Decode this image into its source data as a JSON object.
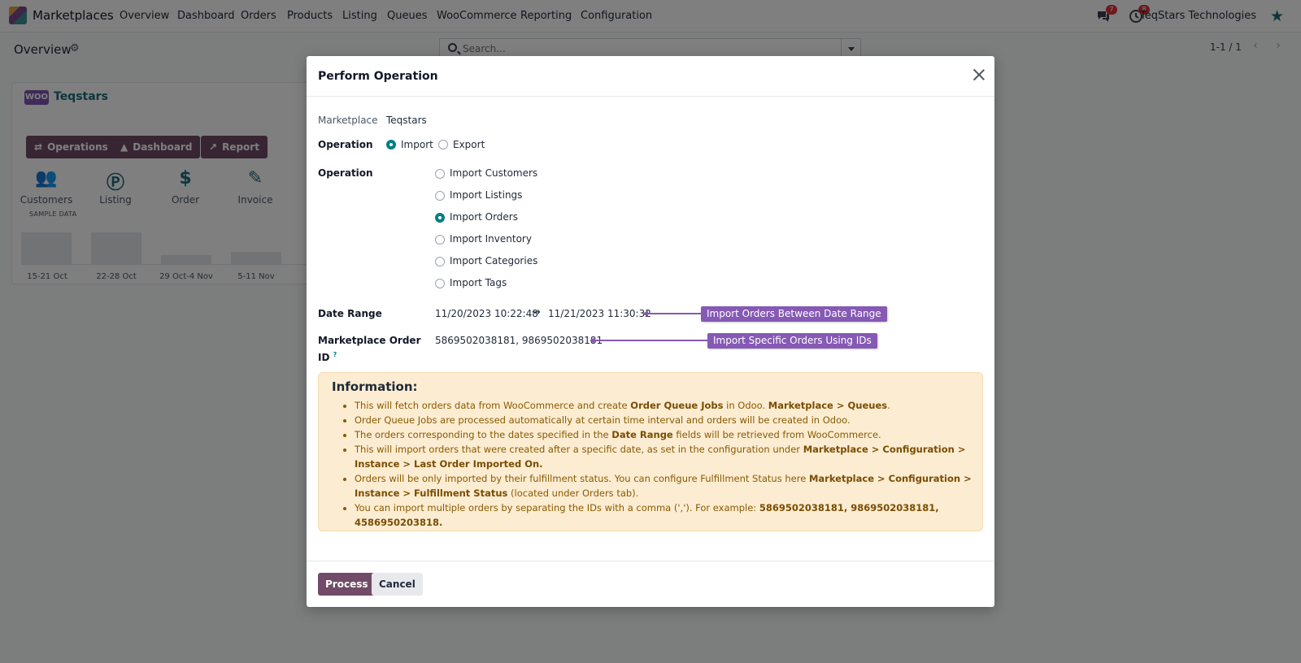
{
  "navbar": {
    "app_name": "Marketplaces",
    "items": [
      "Overview",
      "Dashboard",
      "Orders",
      "Products",
      "Listing",
      "Queues",
      "WooCommerce",
      "Reporting",
      "Configuration"
    ],
    "messages_count": "7",
    "activities_count": "8",
    "company": "TeqStars Technologies"
  },
  "control_panel": {
    "breadcrumb": "Overview",
    "search_placeholder": "Search...",
    "pager": "1-1 / 1"
  },
  "card": {
    "logo_text": "WOO",
    "title": "Teqstars",
    "buttons": [
      "Operations",
      "Dashboard",
      "Report"
    ],
    "stats": [
      "Customers",
      "Listing",
      "Order",
      "Invoice"
    ],
    "sample_label": "SAMPLE DATA",
    "chart_labels": [
      "15-21 Oct",
      "22-28 Oct",
      "29 Oct-4 Nov",
      "5-11 Nov"
    ]
  },
  "modal": {
    "title": "Perform Operation",
    "marketplace_label": "Marketplace",
    "marketplace_value": "Teqstars",
    "operation_label": "Operation",
    "direction_options": [
      "Import",
      "Export"
    ],
    "direction_selected": "Import",
    "operation_label_2": "Operation",
    "operation_options": [
      "Import Customers",
      "Import Listings",
      "Import Orders",
      "Import Inventory",
      "Import Categories",
      "Import Tags"
    ],
    "operation_selected": "Import Orders",
    "date_range_label": "Date Range",
    "date_from": "11/20/2023 10:22:48",
    "date_arrow": "→",
    "date_to": "11/21/2023 11:30:32",
    "order_id_label": "Marketplace Order ID",
    "order_id_help": "?",
    "order_id_value": "5869502038181, 9869502038181",
    "callout_date": "Import Orders Between Date Range",
    "callout_ids": "Import Specific Orders Using IDs",
    "info_title": "Information:",
    "info_lines": {
      "l1_a": "This will fetch orders data from WooCommerce and create ",
      "l1_b": "Order Queue Jobs",
      "l1_c": " in Odoo. ",
      "l1_d": "Marketplace > Queues",
      "l1_e": ".",
      "l2": "Order Queue Jobs are processed automatically at certain time interval and orders will be created in Odoo.",
      "l3_a": "The orders corresponding to the dates specified in the ",
      "l3_b": "Date Range",
      "l3_c": " fields will be retrieved from WooCommerce.",
      "l4_a": "This will import orders that were created after a specific date, as set in the configuration under ",
      "l4_b": "Marketplace > Configuration > Instance > Last Order Imported On.",
      "l5_a": "Orders will be only imported by their fulfillment status. You can configure Fulfillment Status here ",
      "l5_b": "Marketplace > Configuration > Instance > Fulfillment Status",
      "l5_c": " (located under Orders tab).",
      "l6_a": "You can import multiple orders by separating the IDs with a comma (','). For example: ",
      "l6_b": "5869502038181, 9869502038181, 4586950203818."
    },
    "process_label": "Process",
    "cancel_label": "Cancel"
  },
  "colors": {
    "brand": "#714b67",
    "accent": "#017e84",
    "callout": "#8559b4",
    "info_bg": "#fcecd2"
  }
}
